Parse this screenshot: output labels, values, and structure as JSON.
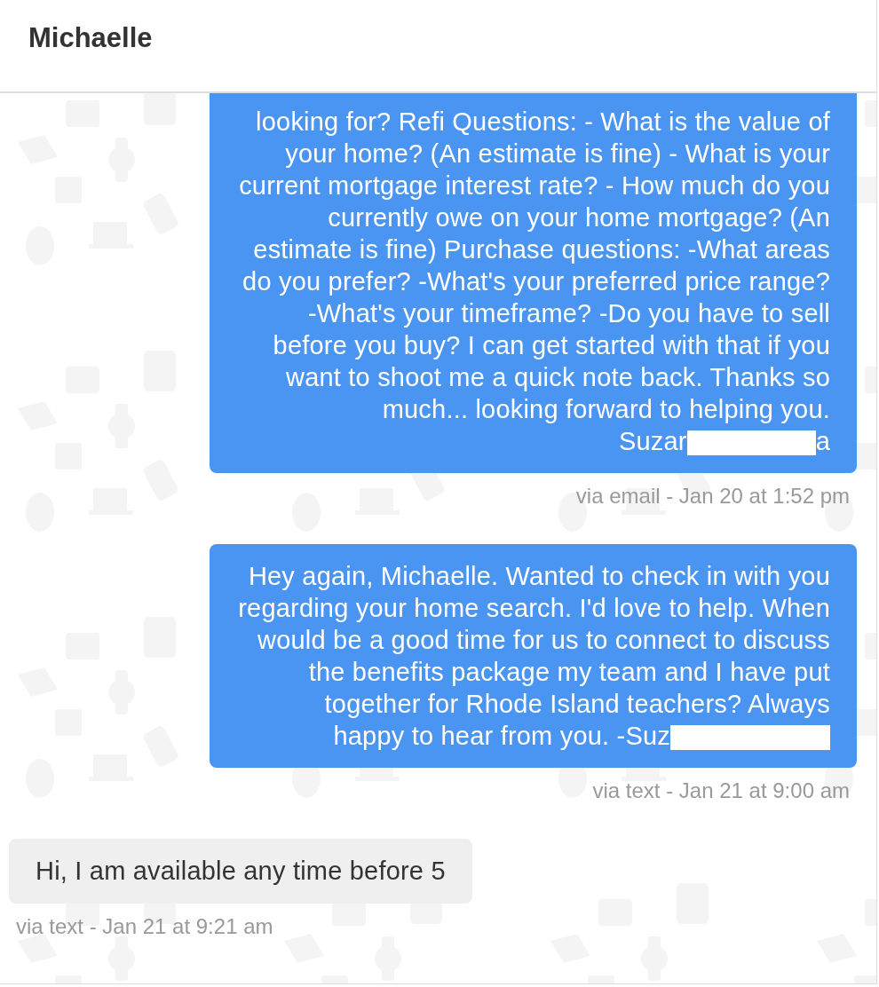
{
  "conversation": {
    "title": "Michaelle"
  },
  "messages": [
    {
      "kind": "outgoing",
      "cut_top": true,
      "text": "looking for? Refi Questions: - What is the value of your home? (An estimate is fine) - What is your current mortgage interest rate? - How much do you currently owe on your home mortgage? (An estimate is fine) Purchase questions: -What areas do you prefer? -What's your preferred price range? -What's your timeframe? -Do you have to sell before you buy? I can get started with that if you want to shoot me a quick note back. Thanks so much... looking forward to helping you.",
      "signature": "Suzar",
      "signature_end": "a",
      "redacted": true,
      "meta": "via email - Jan 20 at 1:52 pm"
    },
    {
      "kind": "outgoing",
      "cut_top": false,
      "text": "Hey again, Michaelle. Wanted to check in with you regarding your home search. I'd love to help. When would be a good time for us to connect to discuss the benefits package my team and I have put together for Rhode Island teachers? Always",
      "signature": "happy to hear from you. -Suz",
      "redacted": true,
      "meta": "via text - Jan 21 at 9:00 am"
    },
    {
      "kind": "incoming",
      "cut_top": false,
      "text": "Hi, I am available any time before 5",
      "meta": "via text - Jan 21 at 9:21 am"
    }
  ]
}
